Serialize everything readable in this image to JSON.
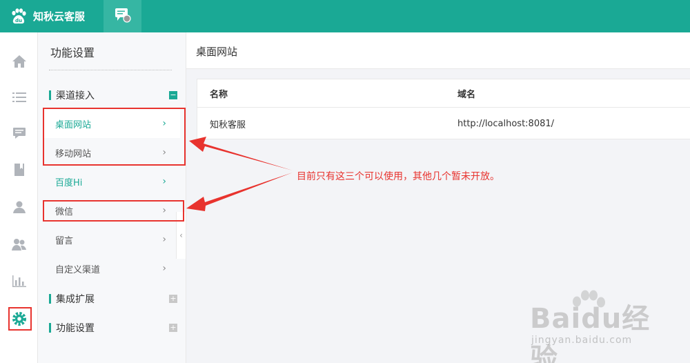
{
  "app": {
    "title": "知秋云客服"
  },
  "submenu": {
    "title": "功能设置",
    "groups": [
      {
        "label": "渠道接入",
        "toggle": "−"
      },
      {
        "label": "集成扩展",
        "toggle": "+"
      },
      {
        "label": "功能设置",
        "toggle": "+"
      }
    ],
    "items": [
      {
        "label": "桌面网站",
        "chevron": "›"
      },
      {
        "label": "移动网站",
        "chevron": "›"
      },
      {
        "label": "百度Hi",
        "chevron": "›"
      },
      {
        "label": "微信",
        "chevron": "›"
      },
      {
        "label": "留言",
        "chevron": "›"
      },
      {
        "label": "自定义渠道",
        "chevron": "›"
      }
    ],
    "collapse_glyph": "‹"
  },
  "main": {
    "title": "桌面网站",
    "table": {
      "headers": [
        "名称",
        "域名"
      ],
      "rows": [
        [
          "知秋客服",
          "http://localhost:8081/"
        ]
      ]
    }
  },
  "annotation": {
    "text": "目前只有这三个可以使用，其他几个暂未开放。"
  },
  "watermark": {
    "text": "Baidu经验",
    "sub": "jingyan.baidu.com"
  },
  "icons": [
    "baidu-logo-icon",
    "chat-icon",
    "home-icon",
    "list-icon",
    "message-icon",
    "book-icon",
    "user-icon",
    "users-icon",
    "chart-icon",
    "settings-icon"
  ],
  "colors": {
    "brand": "#1aa995",
    "annotation": "#e8332e"
  }
}
